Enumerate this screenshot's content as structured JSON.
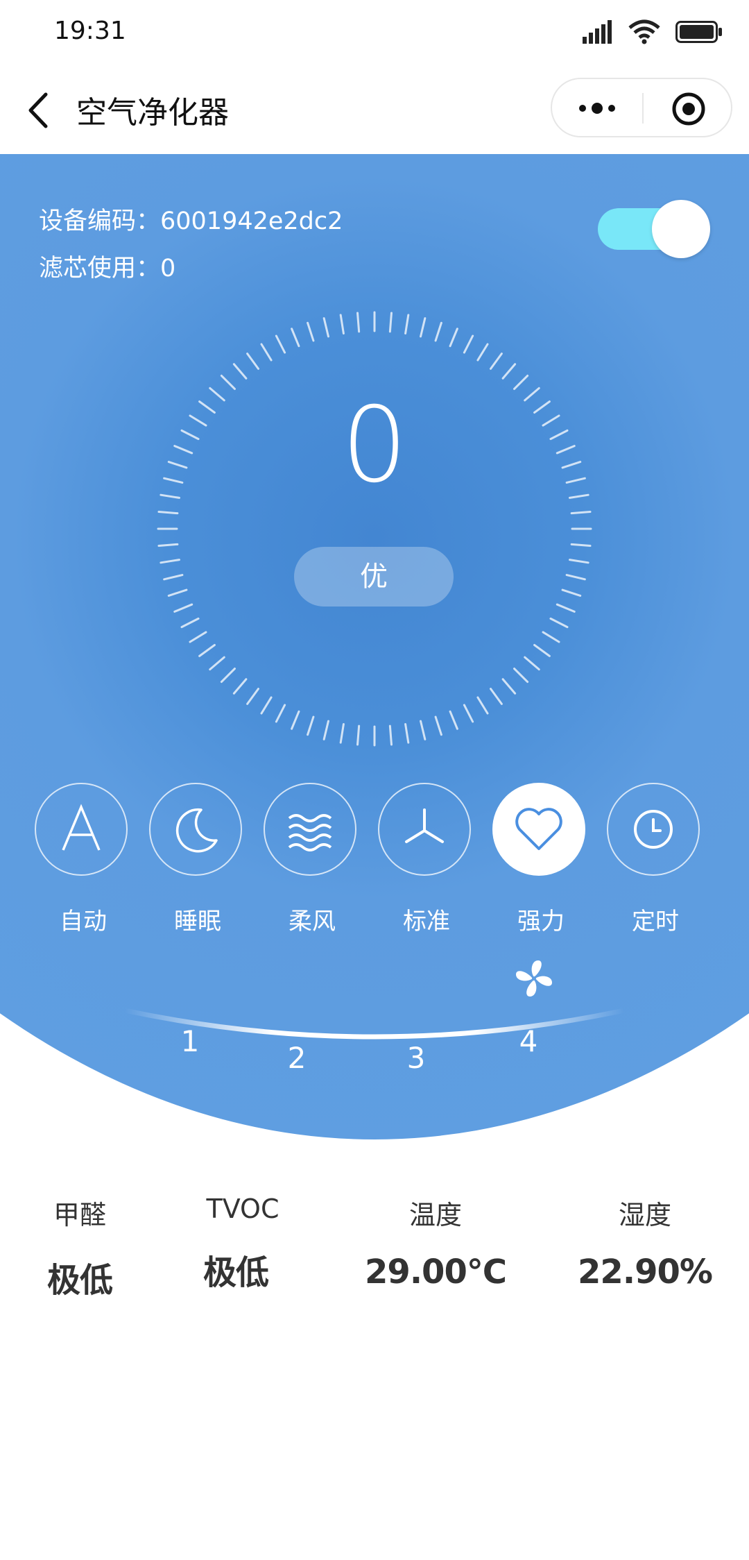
{
  "status_bar": {
    "time": "19:31"
  },
  "nav": {
    "title": "空气净化器"
  },
  "device": {
    "code_line": "设备编码：6001942e2dc2",
    "filter_line": "滤芯使用：0",
    "power_on": true
  },
  "aqi": {
    "value": "0",
    "level": "优"
  },
  "modes": [
    {
      "label": "自动",
      "icon": "auto-icon"
    },
    {
      "label": "睡眠",
      "icon": "moon-icon"
    },
    {
      "label": "柔风",
      "icon": "wave-icon"
    },
    {
      "label": "标准",
      "icon": "fan-blade-icon"
    },
    {
      "label": "强力",
      "icon": "heart-icon",
      "active": true
    },
    {
      "label": "定时",
      "icon": "clock-icon"
    }
  ],
  "fan_speed": {
    "levels": [
      "1",
      "2",
      "3",
      "4"
    ],
    "current": "4"
  },
  "sensors": [
    {
      "name": "甲醛",
      "value": "极低"
    },
    {
      "name": "TVOC",
      "value": "极低"
    },
    {
      "name": "温度",
      "value": "29.00℃"
    },
    {
      "name": "湿度",
      "value": "22.90%"
    }
  ],
  "colors": {
    "panel_blue": "#5f9ee1",
    "toggle_on": "#79e7f8",
    "active_icon": "#4a8fe0"
  }
}
